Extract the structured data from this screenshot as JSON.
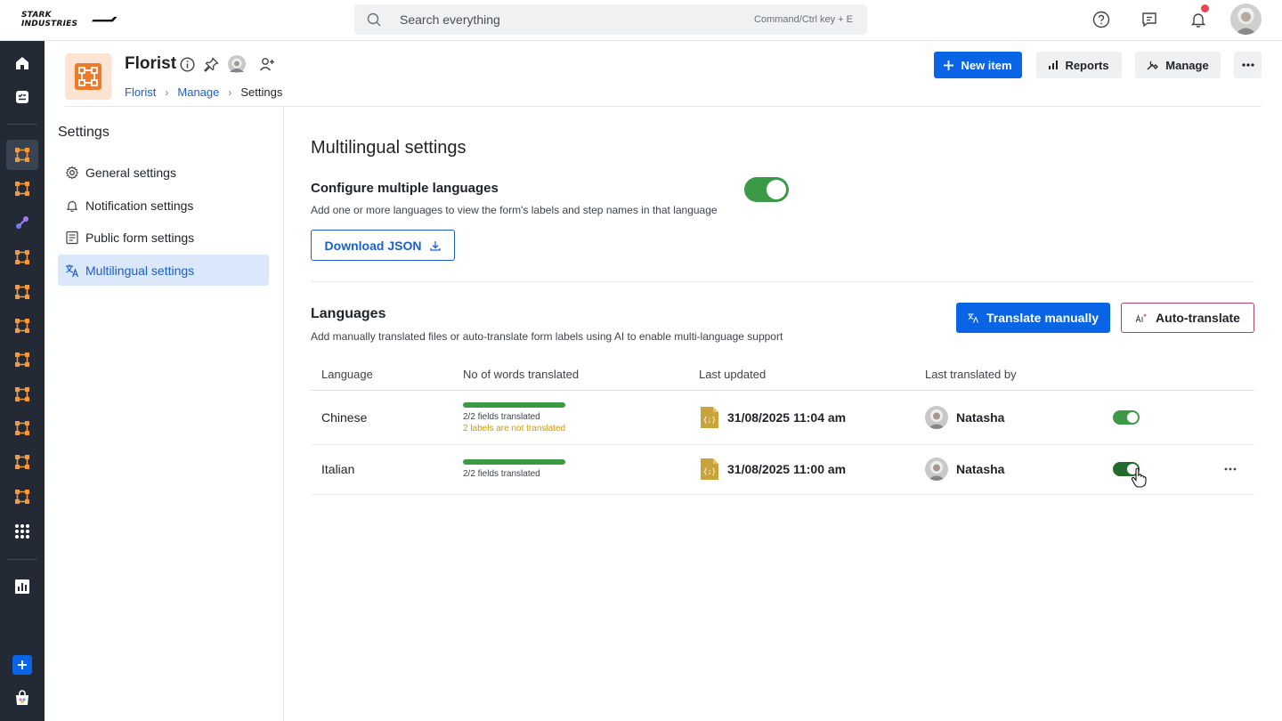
{
  "brand": {
    "logo_text": "STARK INDUSTRIES",
    "accent": "#0a64e6",
    "app_orange": "#f07a2c",
    "toggle_green": "#3c9a47"
  },
  "search": {
    "placeholder": "Search everything",
    "hint": "Command/Ctrl key + E"
  },
  "topbar_icons": [
    "help-icon",
    "feedback-icon",
    "bell-icon"
  ],
  "app": {
    "title": "Florist",
    "breadcrumb": [
      {
        "label": "Florist"
      },
      {
        "label": "Manage"
      },
      {
        "label": "Settings"
      }
    ],
    "buttons": {
      "new_item": "New item",
      "reports": "Reports",
      "manage": "Manage"
    }
  },
  "settings": {
    "title": "Settings",
    "items": [
      {
        "label": "General settings",
        "icon": "gear-icon"
      },
      {
        "label": "Notification settings",
        "icon": "bell-icon"
      },
      {
        "label": "Public form settings",
        "icon": "form-icon"
      },
      {
        "label": "Multilingual settings",
        "icon": "translate-icon",
        "active": true
      }
    ]
  },
  "main": {
    "title": "Multilingual settings",
    "configure": {
      "title": "Configure multiple languages",
      "subtitle": "Add one or more languages to view the form's labels and step names in that language",
      "enabled": true,
      "download_label": "Download JSON"
    },
    "languages": {
      "title": "Languages",
      "subtitle": "Add manually translated files or auto-translate form labels using AI to enable multi-language support",
      "translate_manually": "Translate manually",
      "auto_translate": "Auto-translate",
      "columns": [
        "Language",
        "No of words translated",
        "Last updated",
        "Last translated by"
      ],
      "rows": [
        {
          "language": "Chinese",
          "progress": 1.0,
          "fields": "2/2 fields translated",
          "warning": "2 labels are not translated",
          "updated": "31/08/2025 11:04 am",
          "user": "Natasha",
          "enabled": true
        },
        {
          "language": "Italian",
          "progress": 1.0,
          "fields": "2/2 fields translated",
          "warning": "",
          "updated": "31/08/2025 11:00 am",
          "user": "Natasha",
          "enabled": true
        }
      ]
    }
  }
}
